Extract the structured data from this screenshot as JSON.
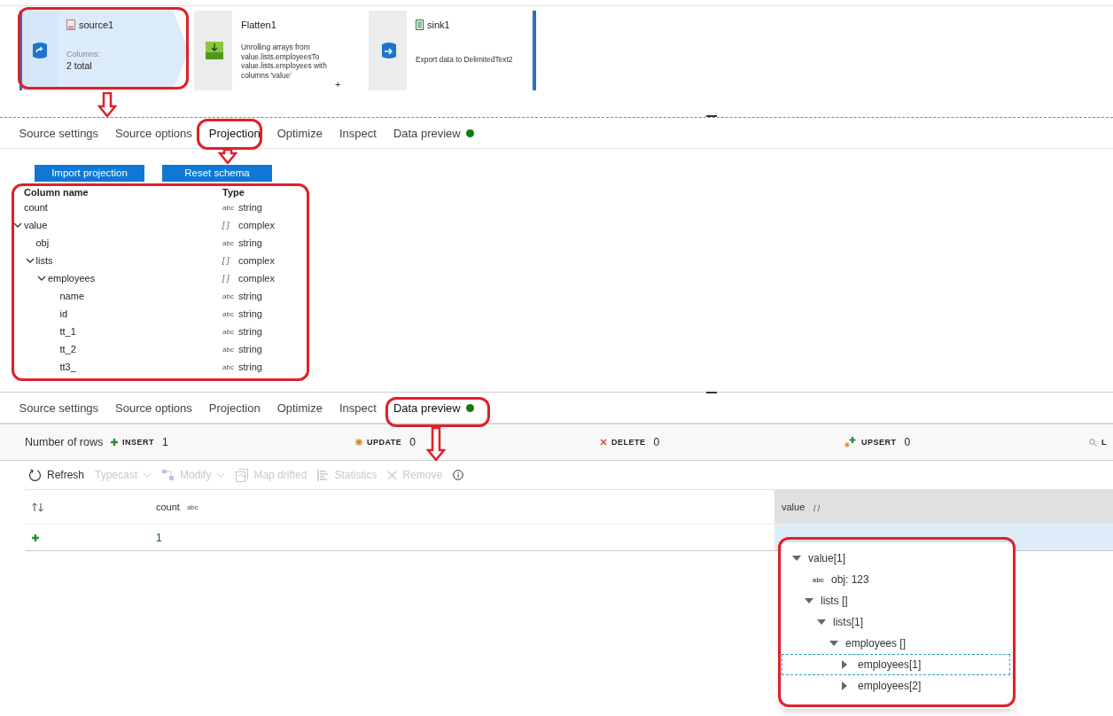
{
  "pipeline": {
    "nodes": [
      {
        "kind": "source",
        "name": "source1",
        "selected": true,
        "label": "Columns:",
        "value": "2 total"
      },
      {
        "kind": "flatten",
        "name": "Flatten1",
        "selected": false,
        "description": "Unrolling arrays from value.lists.employeesTo value.lists.employees with columns 'value'"
      },
      {
        "kind": "sink",
        "name": "sink1",
        "selected": false,
        "description": "Export data to DelimitedText2"
      }
    ],
    "add_label": "+"
  },
  "settings_tabs": [
    {
      "label": "Source settings",
      "selected": false,
      "indicator": false
    },
    {
      "label": "Source options",
      "selected": false,
      "indicator": false
    },
    {
      "label": "Projection",
      "selected": true,
      "indicator": false
    },
    {
      "label": "Optimize",
      "selected": false,
      "indicator": false
    },
    {
      "label": "Inspect",
      "selected": false,
      "indicator": false
    },
    {
      "label": "Data preview",
      "selected": false,
      "indicator": true
    }
  ],
  "projection": {
    "buttons": [
      "Import projection",
      "Reset schema"
    ],
    "columns": [
      "Column name",
      "Type"
    ],
    "rows": [
      {
        "name": "count",
        "type_icon": "abc",
        "type": "string"
      },
      {
        "name": "value",
        "type_icon": "[ ]",
        "type": "complex",
        "expanded": true,
        "children": [
          {
            "name": "obj",
            "type_icon": "abc",
            "type": "string"
          },
          {
            "name": "lists",
            "type_icon": "[ ]",
            "type": "complex",
            "expanded": true,
            "children": [
              {
                "name": "employees",
                "type_icon": "[ ]",
                "type": "complex",
                "expanded": true,
                "children": [
                  {
                    "name": "name",
                    "type_icon": "abc",
                    "type": "string"
                  },
                  {
                    "name": "id",
                    "type_icon": "abc",
                    "type": "string"
                  },
                  {
                    "name": "tt_1",
                    "type_icon": "abc",
                    "type": "string"
                  },
                  {
                    "name": "tt_2",
                    "type_icon": "abc",
                    "type": "string"
                  },
                  {
                    "name": "tt3_",
                    "type_icon": "abc",
                    "type": "string"
                  }
                ]
              }
            ]
          }
        ]
      }
    ]
  },
  "preview_tabs": [
    {
      "label": "Source settings",
      "selected": false,
      "indicator": false
    },
    {
      "label": "Source options",
      "selected": false,
      "indicator": false
    },
    {
      "label": "Projection",
      "selected": false,
      "indicator": false
    },
    {
      "label": "Optimize",
      "selected": false,
      "indicator": false
    },
    {
      "label": "Inspect",
      "selected": false,
      "indicator": false
    },
    {
      "label": "Data preview",
      "selected": true,
      "indicator": true
    }
  ],
  "row_counts": {
    "label": "Number of rows",
    "items": [
      {
        "kind": "insert",
        "label": "INSERT",
        "value": "1"
      },
      {
        "kind": "update",
        "label": "UPDATE",
        "value": "0"
      },
      {
        "kind": "delete",
        "label": "DELETE",
        "value": "0"
      },
      {
        "kind": "upsert",
        "label": "UPSERT",
        "value": "0"
      },
      {
        "kind": "lookup",
        "label": "L"
      }
    ]
  },
  "toolbar": [
    {
      "kind": "refresh",
      "label": "Refresh",
      "disabled": false,
      "dropdown": false
    },
    {
      "kind": "typecast",
      "label": "Typecast",
      "disabled": true,
      "dropdown": true
    },
    {
      "kind": "modify",
      "label": "Modify",
      "disabled": true,
      "dropdown": true
    },
    {
      "kind": "map",
      "label": "Map drifted",
      "disabled": true,
      "dropdown": false
    },
    {
      "kind": "statistics",
      "label": "Statistics",
      "disabled": true,
      "dropdown": false
    },
    {
      "kind": "remove",
      "label": "Remove",
      "disabled": true,
      "dropdown": false
    },
    {
      "kind": "info",
      "disabled": false,
      "dropdown": false
    }
  ],
  "grid": {
    "columns": [
      {
        "kind": "sort"
      },
      {
        "kind": "data",
        "label": "count",
        "type_icon": "abc",
        "selected": false
      },
      {
        "kind": "data",
        "label": "value",
        "type_icon": "[ ]",
        "selected": true
      }
    ],
    "rows": [
      {
        "kind": "insert",
        "cells": [
          "1"
        ],
        "selected": true
      }
    ]
  },
  "value_popup": {
    "tree": [
      {
        "label": "value[1]",
        "expanded": true,
        "children": [
          {
            "label": "obj: 123",
            "type_icon": "abc"
          },
          {
            "label": "lists []",
            "expanded": true,
            "children": [
              {
                "label": "lists[1]",
                "expanded": true,
                "children": [
                  {
                    "label": "employees []",
                    "expanded": true,
                    "children": [
                      {
                        "label": "employees[1]",
                        "expanded": false,
                        "selected": true
                      },
                      {
                        "label": "employees[2]",
                        "expanded": false,
                        "selected": false
                      }
                    ]
                  }
                ]
              }
            ]
          }
        ]
      }
    ]
  }
}
